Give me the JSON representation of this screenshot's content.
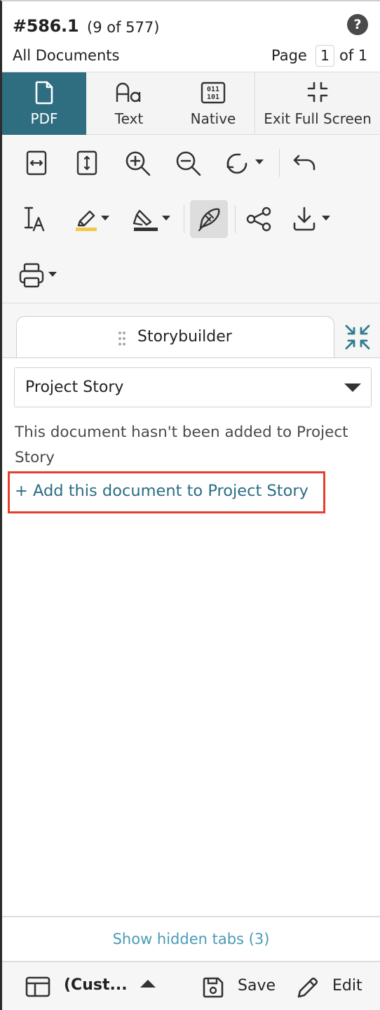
{
  "header": {
    "doc_id": "#586.1",
    "doc_count": "(9 of 577)",
    "collection": "All Documents",
    "page_label": "Page",
    "page_value": "1",
    "page_of": "of 1",
    "help_glyph": "?"
  },
  "view_tabs": [
    {
      "label": "PDF",
      "icon": "pdf-file-icon",
      "active": true
    },
    {
      "label": "Text",
      "icon": "text-aa-icon",
      "active": false
    },
    {
      "label": "Native",
      "icon": "binary-file-icon",
      "active": false
    },
    {
      "label": "Exit Full Screen",
      "icon": "exit-fullscreen-icon",
      "active": false
    }
  ],
  "toolbar": {
    "icons": [
      "fit-width-icon",
      "fit-height-icon",
      "zoom-in-icon",
      "zoom-out-icon",
      "rotate-icon",
      "undo-icon",
      "text-select-icon",
      "highlight-icon",
      "redact-icon",
      "annotate-pen-icon",
      "share-icon",
      "download-icon",
      "print-icon"
    ],
    "highlight_color": "#f2c94c",
    "redact_color": "#333333"
  },
  "panel": {
    "tab_title": "Storybuilder",
    "story_select_value": "Project Story",
    "message": "This document hasn't been added to Project Story",
    "add_link": "+ Add this document to Project Story"
  },
  "bottom": {
    "hidden_tabs": "Show hidden tabs (3)",
    "layout_label": "(Cust...",
    "save_label": "Save",
    "edit_label": "Edit"
  },
  "colors": {
    "accent": "#2f6e80",
    "link": "#2a6e82",
    "hidden_tabs_link": "#4a9bb6",
    "highlight_box": "#e5402b"
  }
}
